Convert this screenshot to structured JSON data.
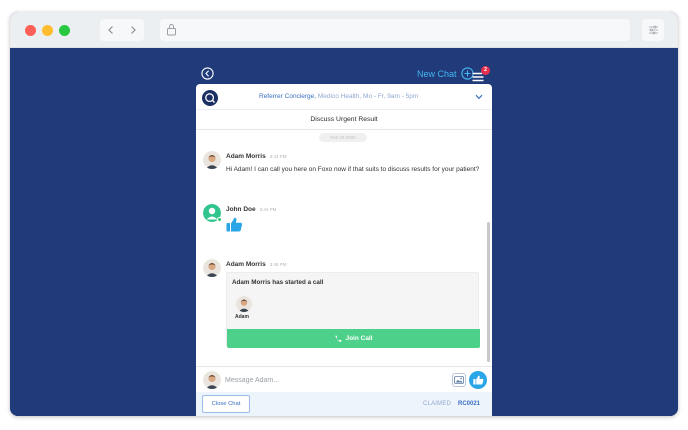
{
  "chat": {
    "new_chat_label": "New Chat",
    "badge_count": "2",
    "header_title": "Referrer Concierge,",
    "header_subtitle": " Medico Health, Mo - Fr, 9am - 5pm",
    "subject": "Discuss Urgent Result",
    "date_divider": "Feb 20 2020",
    "composer_placeholder": "Message Adam...",
    "close_label": "Close Chat",
    "status_label": "CLAIMED",
    "ticket_code": "RC0021"
  },
  "messages": [
    {
      "name": "Adam Morris",
      "time": "3:44 PM",
      "text": "Hi Adam! I can call you here on Foxo now if that suits to discuss results for your patient?"
    },
    {
      "name": "John Doe",
      "time": "3:44 PM",
      "text": ""
    },
    {
      "name": "Adam Morris",
      "time": "3:45 PM",
      "text": ""
    }
  ],
  "call": {
    "title": "Adam Morris has started a call",
    "participant": "Adam",
    "join_label": "Join Call"
  },
  "icons": {
    "back": "back-circle-icon",
    "new_chat": "plus-circle-icon",
    "menu": "list-menu-icon",
    "logo": "concierge-logo-icon",
    "collapse": "chevron-down-icon",
    "thumbs_up": "thumbs-up-icon",
    "phone": "phone-icon",
    "mic": "microphone-icon",
    "image": "image-icon",
    "lock": "lock-icon",
    "settings": "sliders-icon"
  },
  "colors": {
    "background": "#203a7a",
    "accent": "#45b6f0",
    "join_button": "#4cd08a",
    "badge": "#e7304f",
    "link": "#3a6fc0"
  }
}
